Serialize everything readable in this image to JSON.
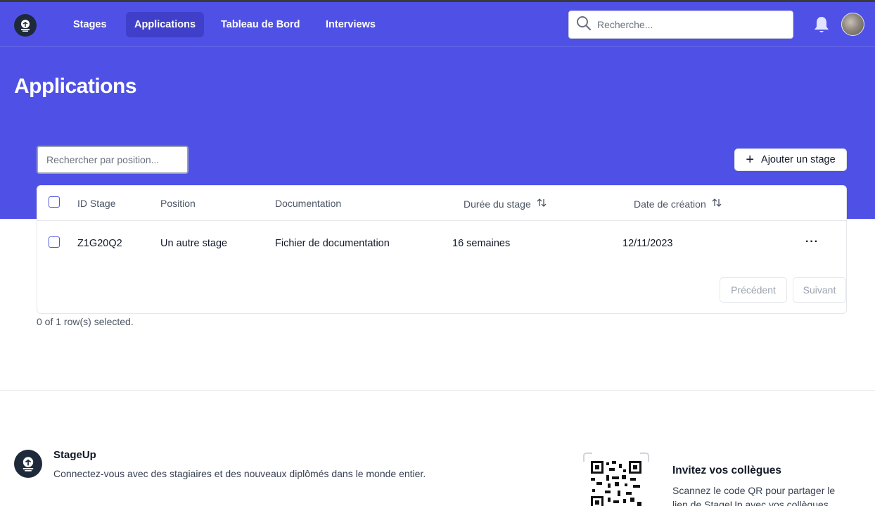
{
  "nav": {
    "items": [
      {
        "label": "Stages",
        "active": false
      },
      {
        "label": "Applications",
        "active": true
      },
      {
        "label": "Tableau de Bord",
        "active": false
      },
      {
        "label": "Interviews",
        "active": false
      }
    ],
    "search_placeholder": "Recherche..."
  },
  "page": {
    "title": "Applications",
    "filter_placeholder": "Rechercher par position...",
    "add_button_label": "Ajouter un stage"
  },
  "table": {
    "columns": [
      "ID Stage",
      "Position",
      "Documentation",
      "Durée du stage",
      "Date de création"
    ],
    "rows": [
      {
        "id": "Z1G20Q2",
        "position": "Un autre stage",
        "documentation": "Fichier de documentation",
        "duration": "16 semaines",
        "created": "12/11/2023"
      }
    ],
    "more_label": "···",
    "pagination": {
      "previous": "Précédent",
      "next": "Suivant"
    },
    "selection_info": "0 of 1 row(s) selected."
  },
  "footer": {
    "brand": "StageUp",
    "tagline": "Connectez-vous avec des stagiaires et des nouveaux diplômés dans le monde entier.",
    "invite_title": "Invitez vos collègues",
    "invite_text": "Scannez le code QR pour partager le lien de StageUp avec vos collègues."
  },
  "colors": {
    "brand": "#4f51e6",
    "nav_active": "#3f3fc9",
    "logo_bg": "#1e2a3a"
  },
  "icons": {
    "logo": "stageup-logo-icon",
    "search": "search-icon",
    "bell": "bell-icon",
    "plus": "plus-icon",
    "sort": "sort-icon",
    "more": "more-horizontal-icon",
    "qr": "qr-code-icon"
  }
}
